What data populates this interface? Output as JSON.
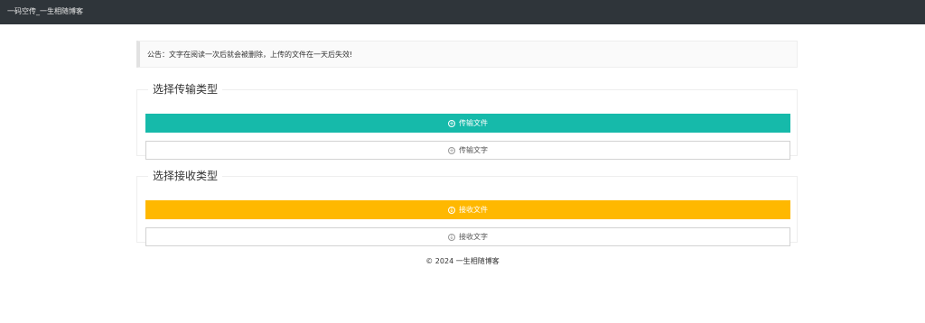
{
  "header": {
    "brand": "一码空传_一生相随博客"
  },
  "notice": {
    "text": "公告：文字在阅读一次后就会被删除，上传的文件在一天后失效!"
  },
  "send": {
    "legend": "选择传输类型",
    "file_button": "传输文件",
    "text_button": "传输文字",
    "file_icon": "plus-circle-icon",
    "text_icon": "plus-circle-icon"
  },
  "receive": {
    "legend": "选择接收类型",
    "file_button": "接收文件",
    "text_button": "接收文字",
    "file_icon": "download-circle-icon",
    "text_icon": "download-circle-icon"
  },
  "footer": {
    "text": "© 2024 一生相随博客"
  },
  "colors": {
    "topbar": "#2f353a",
    "teal": "#16baaa",
    "orange": "#ffb800"
  }
}
